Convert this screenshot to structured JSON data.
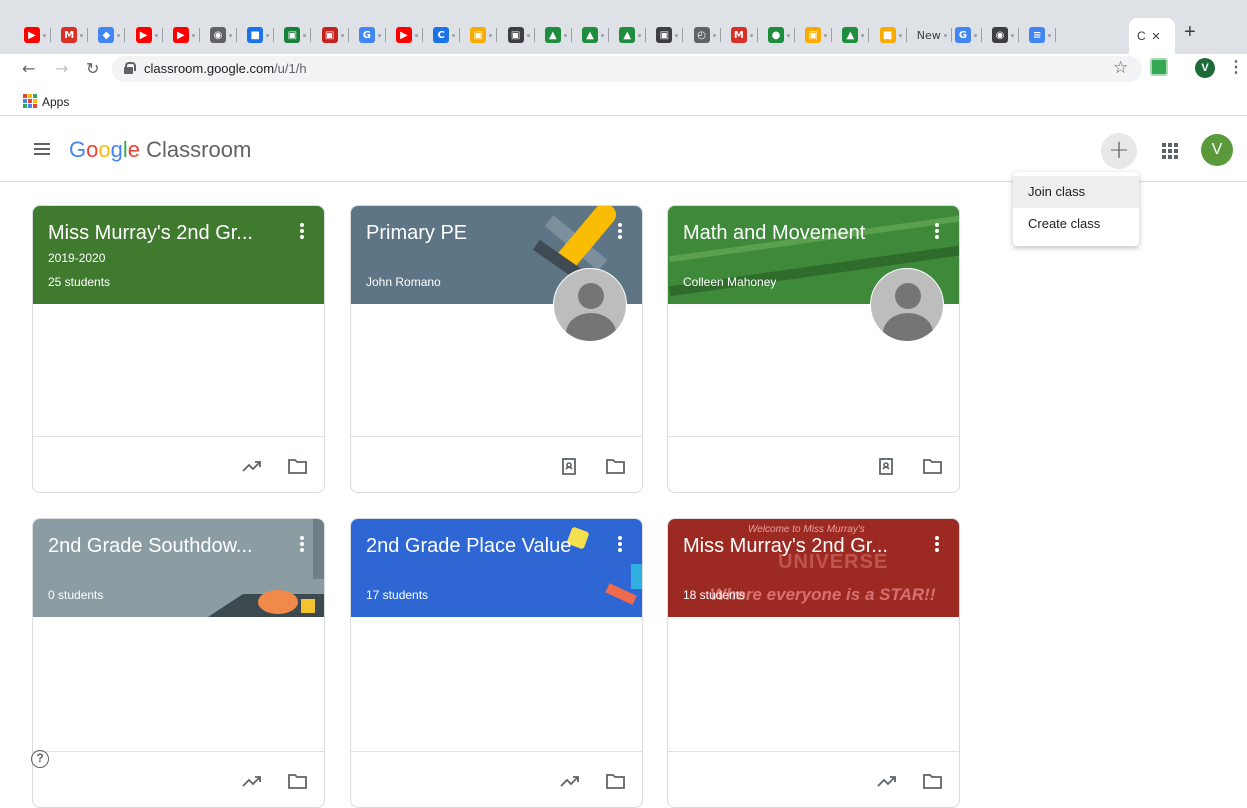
{
  "browser": {
    "tabs": [
      {
        "icon": "youtube-icon",
        "glyph": "▶",
        "color": "#ff0000"
      },
      {
        "icon": "gmail-icon",
        "glyph": "M",
        "color": "#d93025"
      },
      {
        "icon": "app-icon",
        "glyph": "◆",
        "color": "#4285f4"
      },
      {
        "icon": "youtube-icon",
        "glyph": "▶",
        "color": "#ff0000"
      },
      {
        "icon": "youtube-icon",
        "glyph": "▶",
        "color": "#ff0000"
      },
      {
        "icon": "chrome-icon",
        "glyph": "◉",
        "color": "#5f6368"
      },
      {
        "icon": "screencast-icon",
        "glyph": "■",
        "color": "#1a73e8"
      },
      {
        "icon": "classroom-icon",
        "glyph": "▣",
        "color": "#188038"
      },
      {
        "icon": "app-red-icon",
        "glyph": "▣",
        "color": "#c5221f"
      },
      {
        "icon": "google-icon",
        "glyph": "G",
        "color": "#4285f4"
      },
      {
        "icon": "youtube-icon",
        "glyph": "▶",
        "color": "#ff0000"
      },
      {
        "icon": "docs-blue-icon",
        "glyph": "C",
        "color": "#1a73e8"
      },
      {
        "icon": "slides-icon",
        "glyph": "▣",
        "color": "#f9ab00"
      },
      {
        "icon": "app-dark-icon",
        "glyph": "▣",
        "color": "#3c4043"
      },
      {
        "icon": "drive-icon",
        "glyph": "▲",
        "color": "#1e8e3e"
      },
      {
        "icon": "drive-icon",
        "glyph": "▲",
        "color": "#1e8e3e"
      },
      {
        "icon": "drive-icon",
        "glyph": "▲",
        "color": "#1e8e3e"
      },
      {
        "icon": "app-dark-icon",
        "glyph": "▣",
        "color": "#3c4043"
      },
      {
        "icon": "timer-icon",
        "glyph": "◴",
        "color": "#5f6368"
      },
      {
        "icon": "gmail-icon",
        "glyph": "M",
        "color": "#d93025"
      },
      {
        "icon": "app-green-icon",
        "glyph": "●",
        "color": "#1e8e3e"
      },
      {
        "icon": "slides-icon",
        "glyph": "▣",
        "color": "#f9ab00"
      },
      {
        "icon": "drive-icon",
        "glyph": "▲",
        "color": "#1e8e3e"
      },
      {
        "icon": "slides-icon",
        "glyph": "■",
        "color": "#f9ab00"
      },
      {
        "icon": "newtab-text",
        "glyph": "New",
        "color": "#3c4043"
      },
      {
        "icon": "google-icon",
        "glyph": "G",
        "color": "#4285f4"
      },
      {
        "icon": "chrome-icon",
        "glyph": "◉",
        "color": "#3c4043"
      },
      {
        "icon": "docs-icon",
        "glyph": "≡",
        "color": "#4285f4"
      }
    ],
    "active_tab_label": "C",
    "url_host": "classroom.google.com",
    "url_path": "/u/1/h",
    "profile_initial": "V",
    "bookmarks_apps_label": "Apps"
  },
  "header": {
    "brand_google": [
      "G",
      "o",
      "o",
      "g",
      "l",
      "e"
    ],
    "brand_product": "Classroom",
    "user_initial": "V"
  },
  "menu": {
    "items": [
      "Join class",
      "Create class"
    ]
  },
  "classes": [
    {
      "title": "Miss Murray's 2nd Gr...",
      "section": "2019-2020",
      "meta": "25 students",
      "color": "#3f7a2e",
      "teacher_photo": false,
      "show_trends": true
    },
    {
      "title": "Primary PE",
      "section": "",
      "meta": "John Romano",
      "color": "#5d7584",
      "teacher_photo": true,
      "show_trends": false
    },
    {
      "title": "Math and Movement",
      "section": "",
      "meta": "Colleen Mahoney",
      "color": "#3e8a3a",
      "teacher_photo": true,
      "show_trends": false
    },
    {
      "title": "2nd Grade Southdow...",
      "section": "",
      "meta": "0 students",
      "color": "#8c9ca3",
      "teacher_photo": false,
      "show_trends": true
    },
    {
      "title": "2nd Grade Place Value",
      "section": "",
      "meta": "17 students",
      "color": "#2e67d3",
      "teacher_photo": false,
      "show_trends": true
    },
    {
      "title": "Miss Murray's 2nd Gr...",
      "section": "",
      "meta": "18 students",
      "color": "#9c2a22",
      "teacher_photo": false,
      "show_trends": true,
      "banner_text": {
        "line1": "Welcome to Miss Murray's",
        "line2": "UNIVERSE",
        "line3": "Where everyone is a STAR!!"
      }
    }
  ],
  "help_label": "?"
}
